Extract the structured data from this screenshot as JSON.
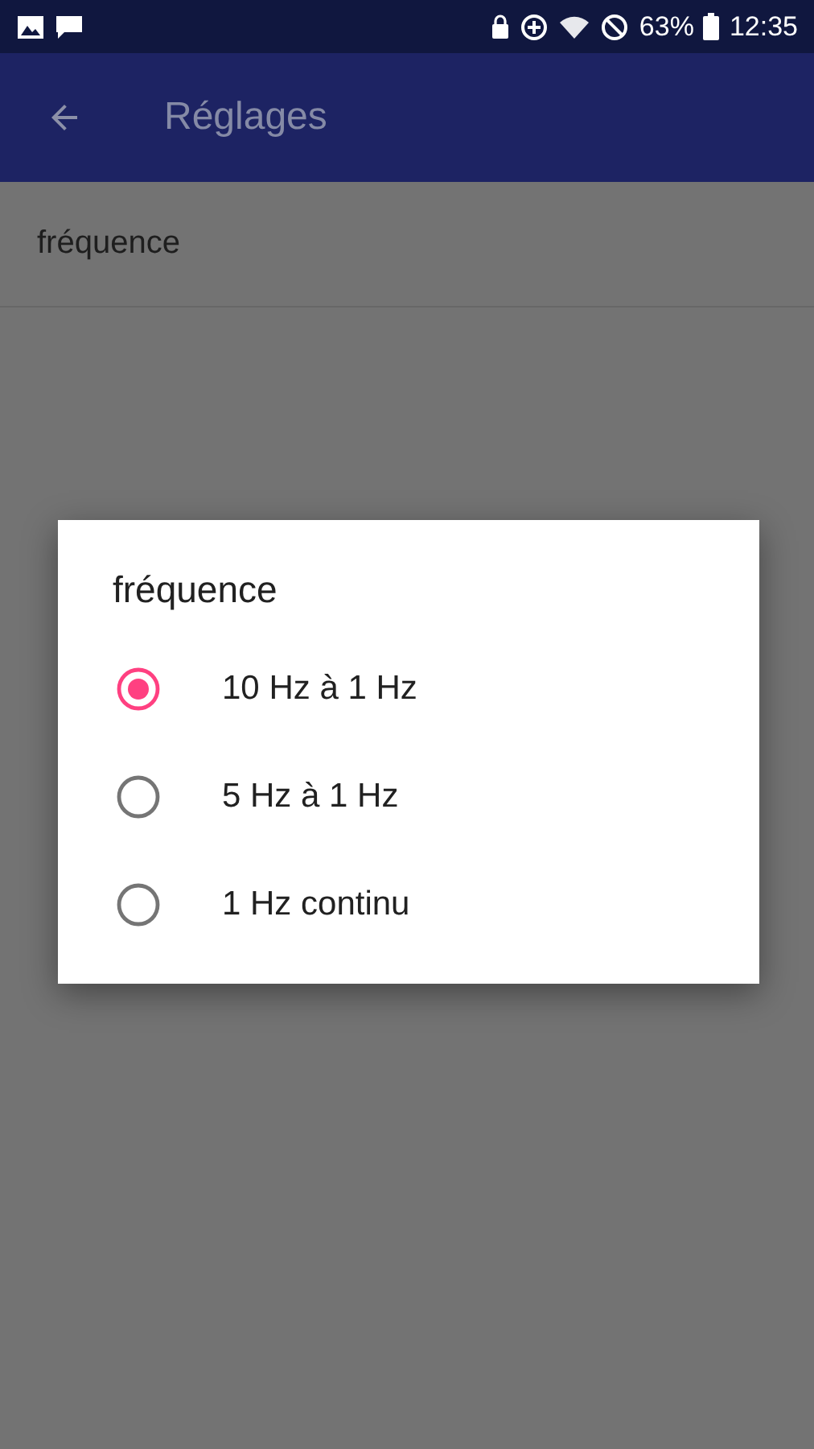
{
  "status_bar": {
    "battery": "63%",
    "time": "12:35"
  },
  "app_bar": {
    "title": "Réglages"
  },
  "settings": [
    {
      "label": "fréquence"
    }
  ],
  "dialog": {
    "title": "fréquence",
    "options": [
      {
        "label": "10 Hz à 1 Hz",
        "selected": true
      },
      {
        "label": "5 Hz à 1 Hz",
        "selected": false
      },
      {
        "label": "1 Hz continu",
        "selected": false
      }
    ]
  }
}
